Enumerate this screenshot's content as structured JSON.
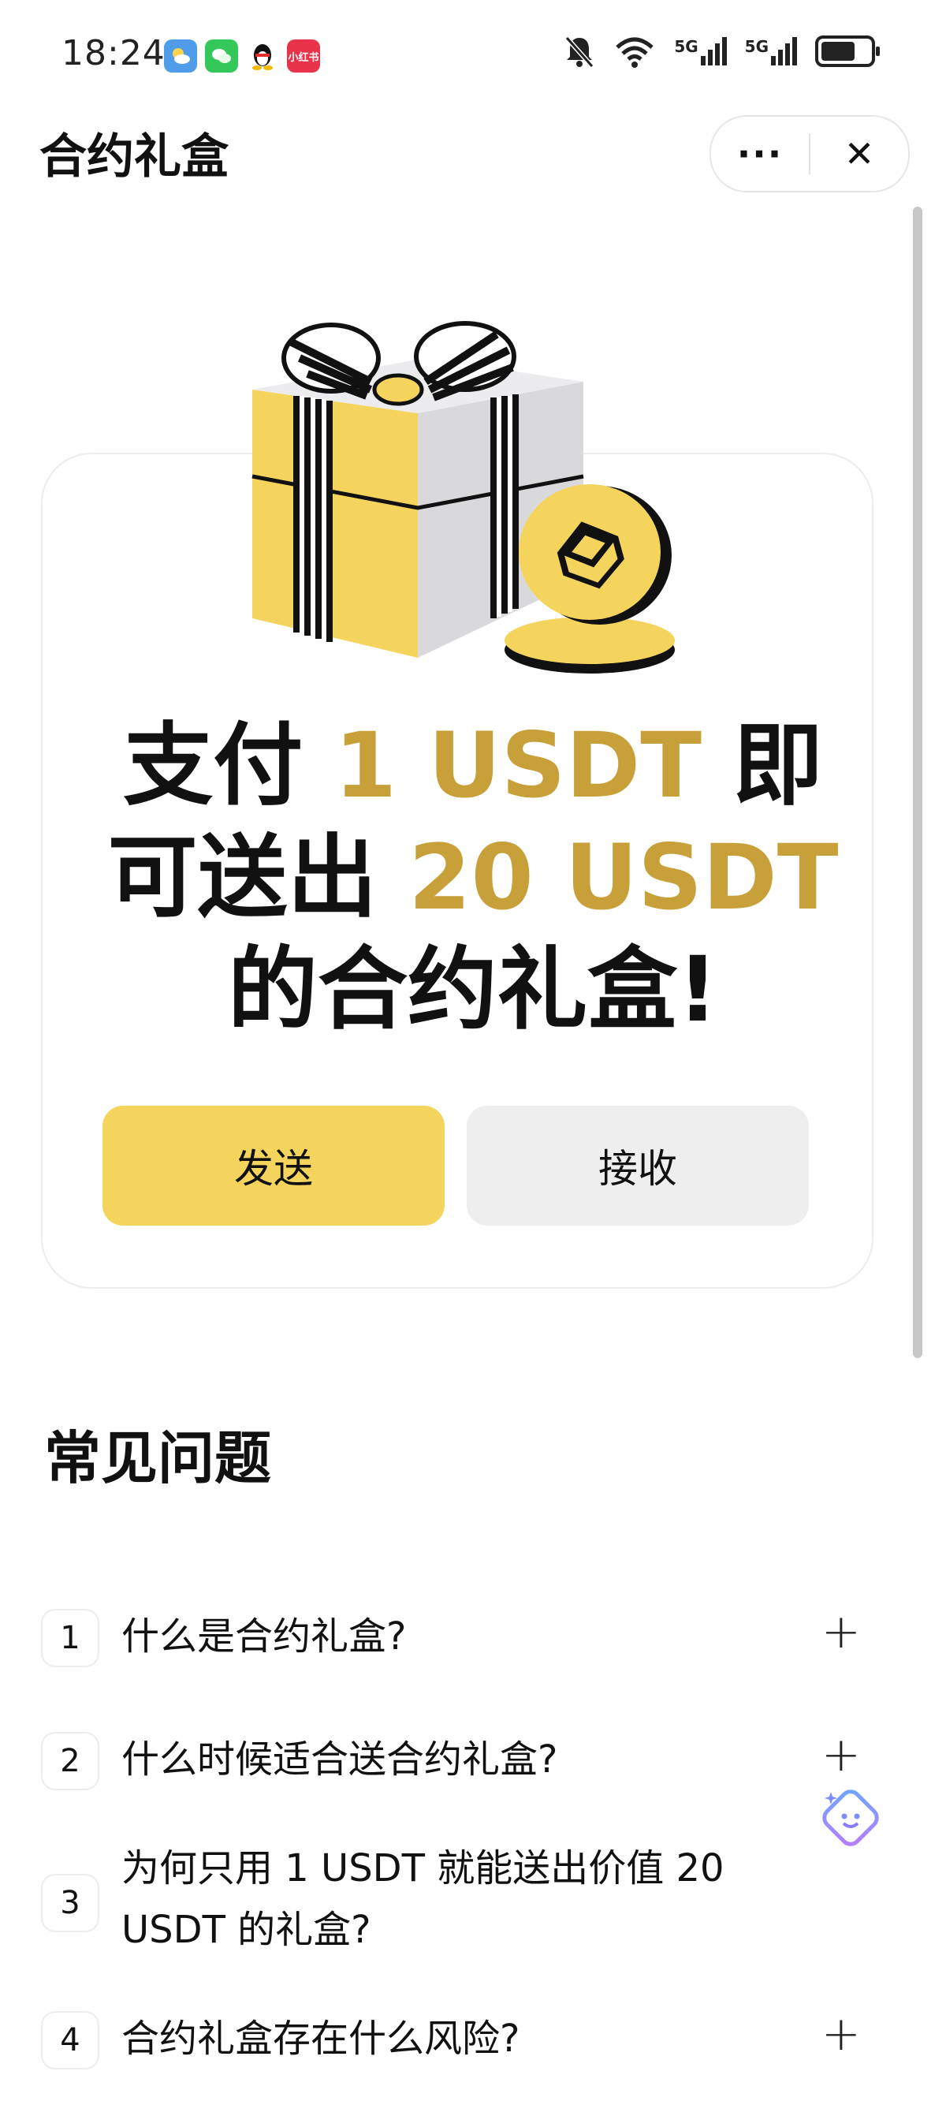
{
  "status_bar": {
    "time": "18:24",
    "app_icons": [
      {
        "icon": "weather-icon",
        "color": "#4f9de8"
      },
      {
        "icon": "wechat-icon",
        "color": "#34c759"
      },
      {
        "icon": "qq-penguin-icon",
        "color": "#ffffff"
      },
      {
        "icon": "xiaohongshu-icon",
        "color": "#e8334a",
        "label": "小红书"
      }
    ],
    "network_1": "5G",
    "network_2": "5G"
  },
  "header": {
    "title": "合约礼盒",
    "more_label": "···",
    "close_label": "✕"
  },
  "promo": {
    "line1_prefix": "支付 ",
    "line1_accent": "1 USDT",
    "line1_suffix": " 即",
    "line2_prefix": "可送出 ",
    "line2_accent": "20 USDT",
    "line3": "的合约礼盒!",
    "send_label": "发送",
    "receive_label": "接收"
  },
  "faq": {
    "title": "常见问题",
    "items": [
      {
        "num": "1",
        "question": "什么是合约礼盒?"
      },
      {
        "num": "2",
        "question": "什么时候适合送合约礼盒?"
      },
      {
        "num": "3",
        "question": "为何只用 1 USDT 就能送出价值 20 USDT 的礼盒?"
      },
      {
        "num": "4",
        "question": "合约礼盒存在什么风险?"
      }
    ],
    "expand_symbol": "+"
  },
  "colors": {
    "accent_gold": "#c8a03a",
    "primary_yellow": "#f4d45c",
    "secondary_gray": "#eeeeee"
  }
}
